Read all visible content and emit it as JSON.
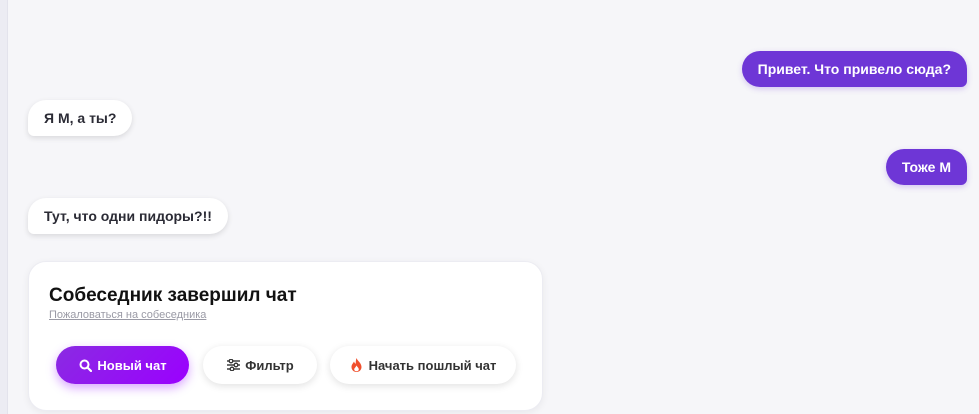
{
  "messages": [
    {
      "side": "out",
      "text": "Привет. Что привело сюда?"
    },
    {
      "side": "in",
      "text": "Я М, а ты?"
    },
    {
      "side": "out",
      "text": "Тоже М"
    },
    {
      "side": "in",
      "text": "Тут, что одни пидоры?!!"
    }
  ],
  "end_card": {
    "title": "Собеседник завершил чат",
    "report_link": "Пожаловаться на собеседника",
    "buttons": {
      "new_chat": {
        "label": "Новый чат",
        "icon": "search-icon"
      },
      "filter": {
        "label": "Фильтр",
        "icon": "sliders-icon"
      },
      "lewd_chat": {
        "label": "Начать пошлый чат",
        "icon": "fire-icon"
      }
    }
  },
  "colors": {
    "outgoing_bubble": "#6e36d6",
    "new_chat_button": "#9b00ff",
    "fire_icon": "#f0502d",
    "background": "#f6f6f9"
  }
}
